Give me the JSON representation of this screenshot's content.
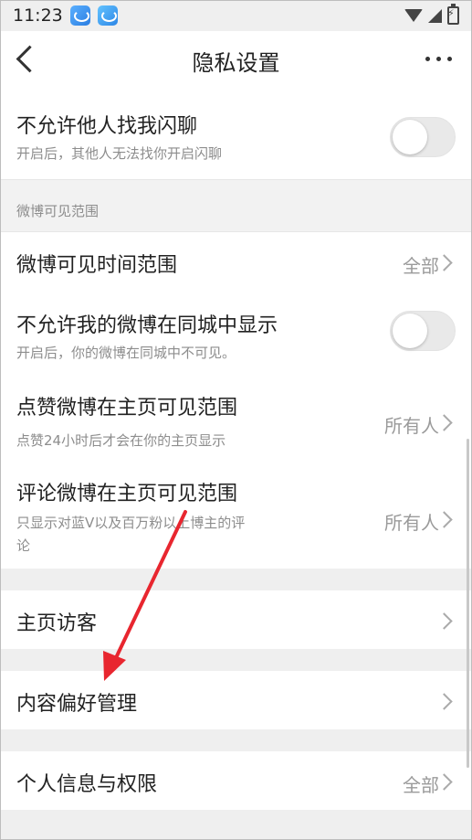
{
  "status_bar": {
    "time": "11:23"
  },
  "nav": {
    "title": "隐私设置"
  },
  "rows": {
    "flash_chat": {
      "label": "不允许他人找我闪聊",
      "sub": "开启后，其他人无法找你开启闪聊"
    },
    "section_weibo": "微博可见范围",
    "time_range": {
      "label": "微博可见时间范围",
      "value": "全部"
    },
    "same_city": {
      "label": "不允许我的微博在同城中显示",
      "sub": "开启后，你的微博在同城中不可见。"
    },
    "likes": {
      "label": "点赞微博在主页可见范围",
      "sub": "点赞24小时后才会在你的主页显示",
      "value": "所有人"
    },
    "comments": {
      "label": "评论微博在主页可见范围",
      "sub1": "只显示对蓝V以及百万粉以上博主的评",
      "sub2": "论",
      "value": "所有人"
    },
    "visitors": {
      "label": "主页访客"
    },
    "content_pref": {
      "label": "内容偏好管理"
    },
    "personal_info": {
      "label": "个人信息与权限",
      "value": "全部"
    }
  },
  "colors": {
    "annotation_arrow": "#e8262f"
  }
}
